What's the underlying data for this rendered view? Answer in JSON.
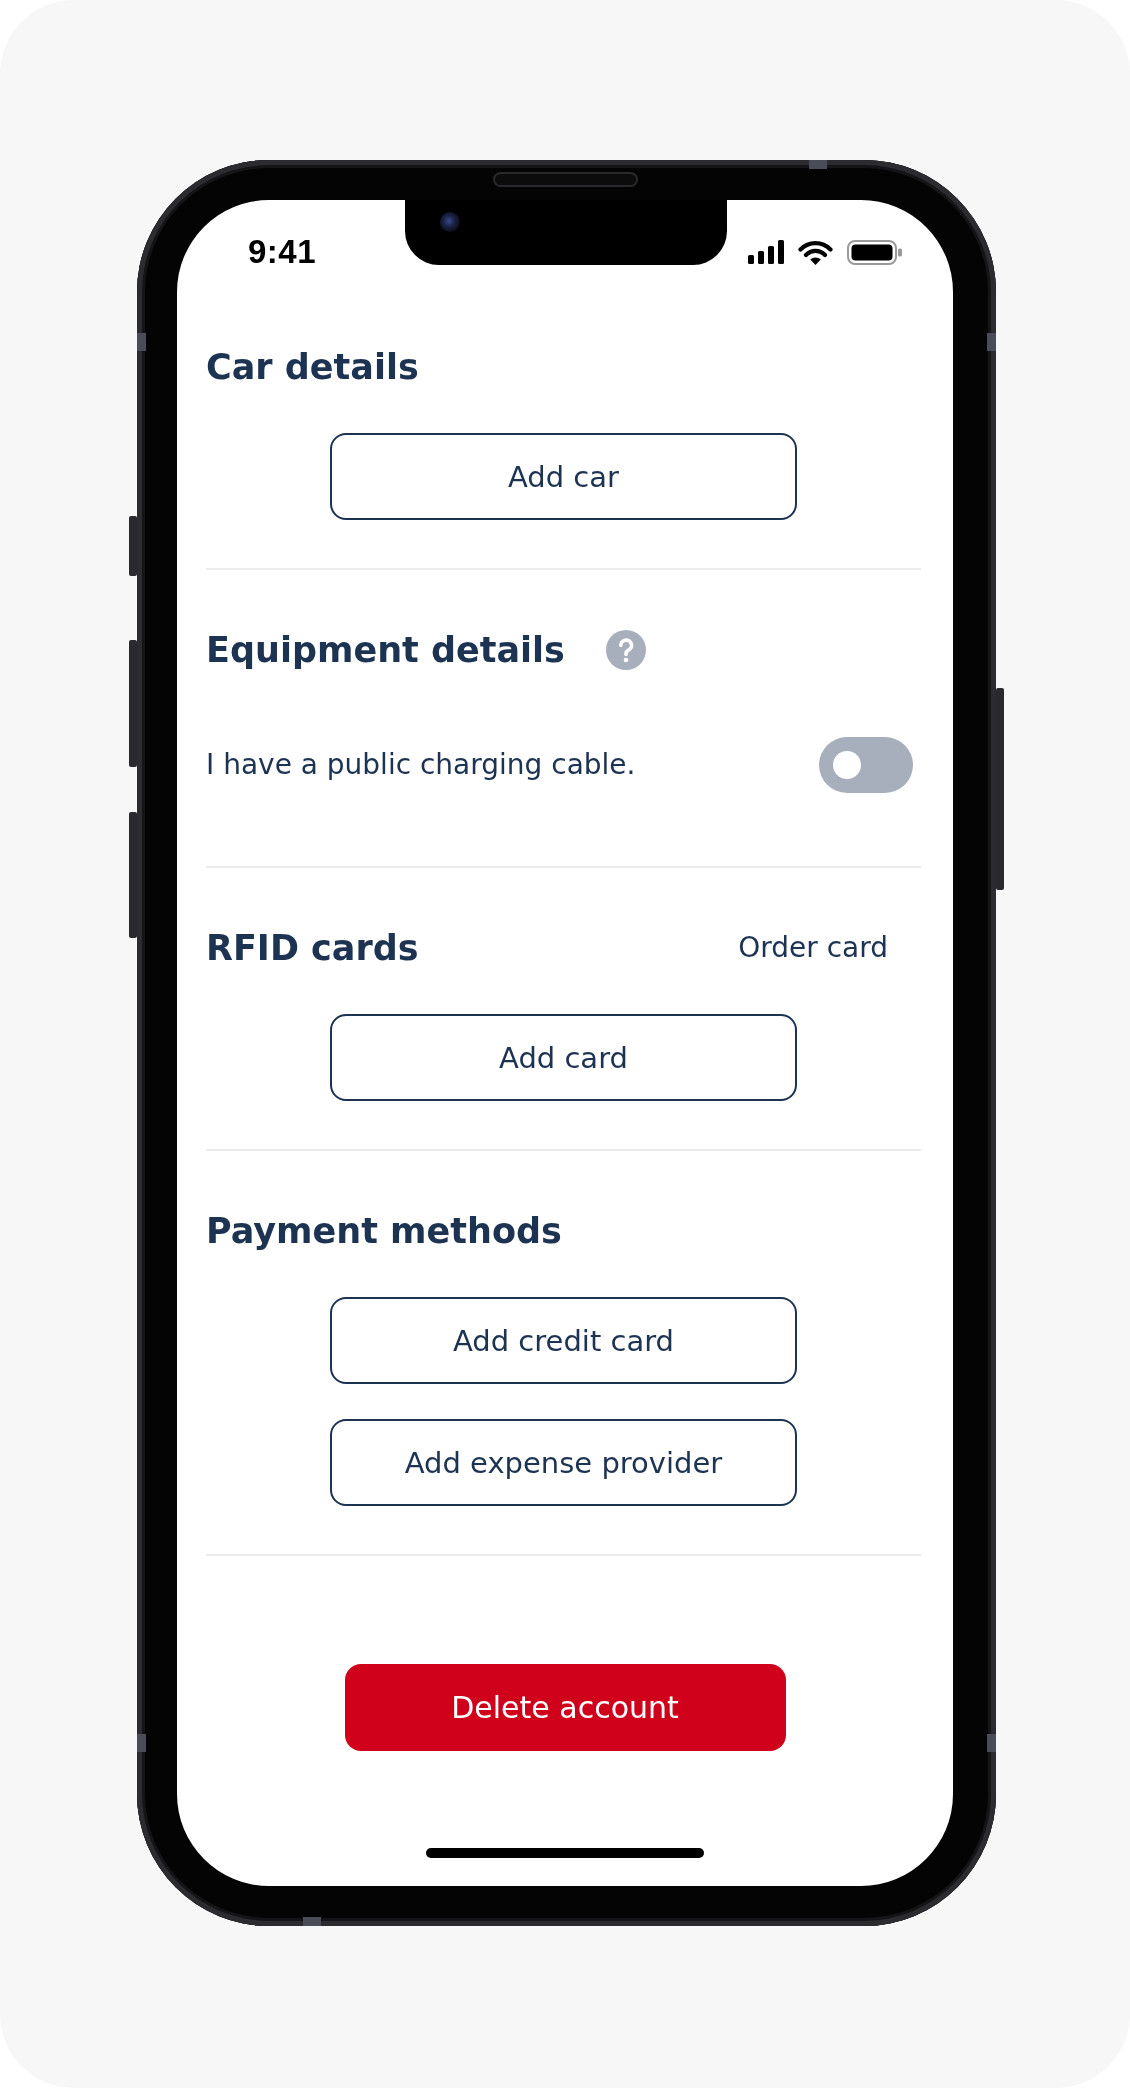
{
  "status_bar": {
    "time": "9:41"
  },
  "sections": [
    {
      "title": "Car details",
      "buttons": [
        "Add car"
      ]
    },
    {
      "title": "Equipment details",
      "help": true,
      "setting": {
        "label": "I have a public charging cable.",
        "on": false
      }
    },
    {
      "title": "RFID cards",
      "link": "Order card",
      "buttons": [
        "Add card"
      ]
    },
    {
      "title": "Payment methods",
      "buttons": [
        "Add credit card",
        "Add expense provider"
      ]
    }
  ],
  "delete_button": {
    "label": "Delete account"
  }
}
